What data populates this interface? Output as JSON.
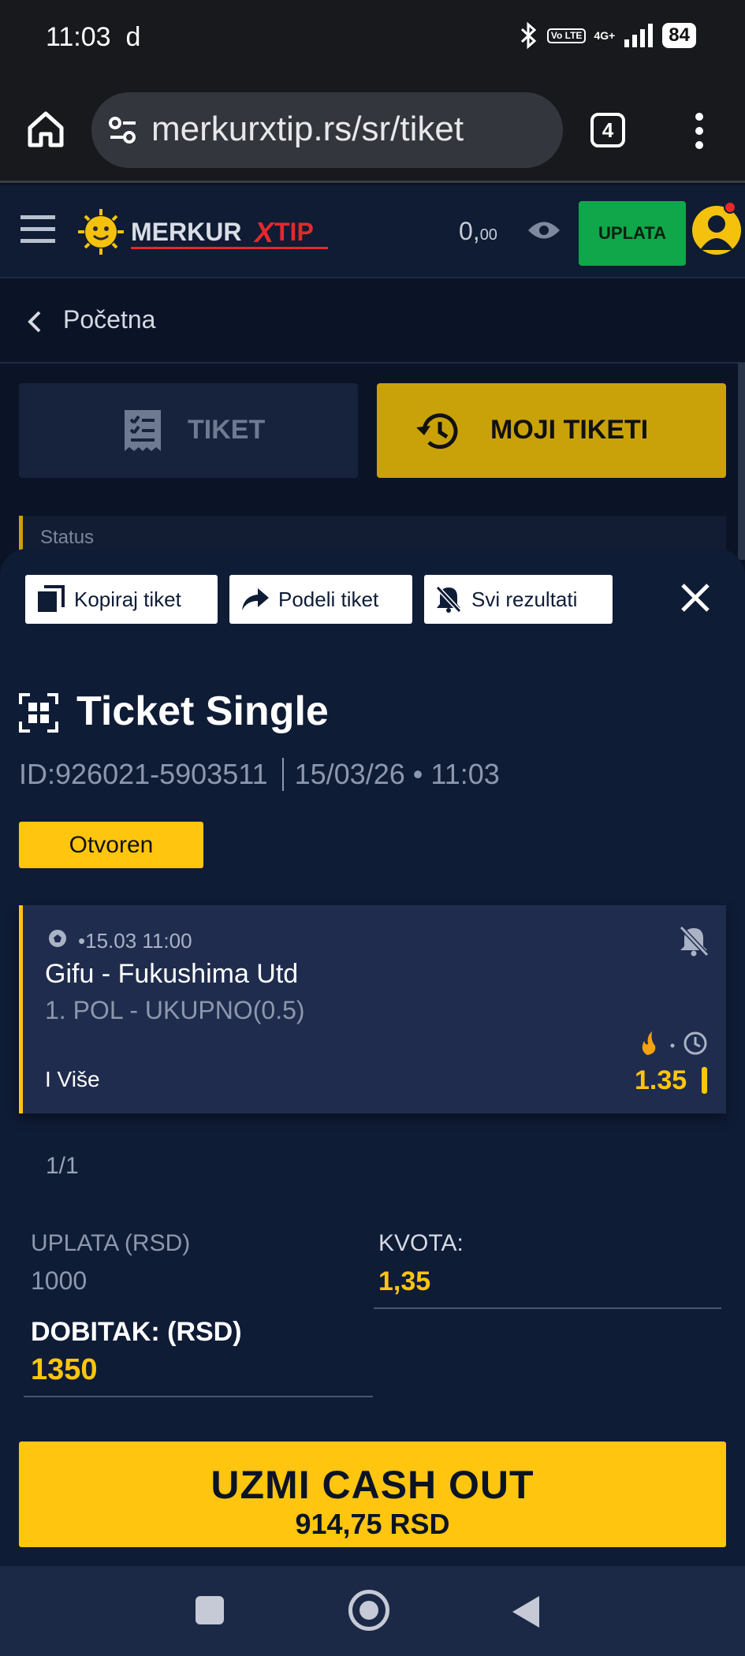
{
  "status_bar": {
    "time": "11:03",
    "carrier_letter": "d",
    "network": "4G+",
    "volte": "Vo LTE",
    "battery": "84"
  },
  "browser": {
    "url": "merkurxtip.rs/sr/tiket",
    "tab_count": "4"
  },
  "header": {
    "logo_text_1": "MERKUR",
    "logo_x": "X",
    "logo_text_2": "TIP",
    "balance_main": "0,",
    "balance_cents": "00",
    "deposit_label": "UPLATA"
  },
  "breadcrumb": {
    "label": "Početna"
  },
  "tabs": {
    "tiket": "TIKET",
    "moji_tiketi": "MOJI TIKETI"
  },
  "status_filter": {
    "label": "Status"
  },
  "sheet": {
    "actions": {
      "copy": "Kopiraj tiket",
      "share": "Podeli tiket",
      "all_results": "Svi rezultati"
    },
    "title": "Ticket Single",
    "ticket_id": "ID:926021-5903511",
    "ticket_datetime": "15/03/26 • 11:03",
    "status_badge": "Otvoren",
    "bet": {
      "datetime": "•15.03 11:00",
      "match": "Gifu - Fukushima Utd",
      "market": "1. POL - UKUPNO(0.5)",
      "pick": "I Više",
      "odd": "1.35"
    },
    "pager": "1/1",
    "summary": {
      "stake_label": "UPLATA (RSD)",
      "stake_value": "1000",
      "odds_label": "KVOTA:",
      "odds_value": "1,35",
      "payout_label": "DOBITAK: (RSD)",
      "payout_value": "1350"
    },
    "cashout": {
      "line1": "UZMI CASH OUT",
      "line2": "914,75 RSD"
    }
  },
  "colors": {
    "accent_yellow": "#ffc50f",
    "deposit_green": "#10a64a",
    "sheet_bg": "#0f1c36",
    "page_bg": "#0b1426"
  }
}
